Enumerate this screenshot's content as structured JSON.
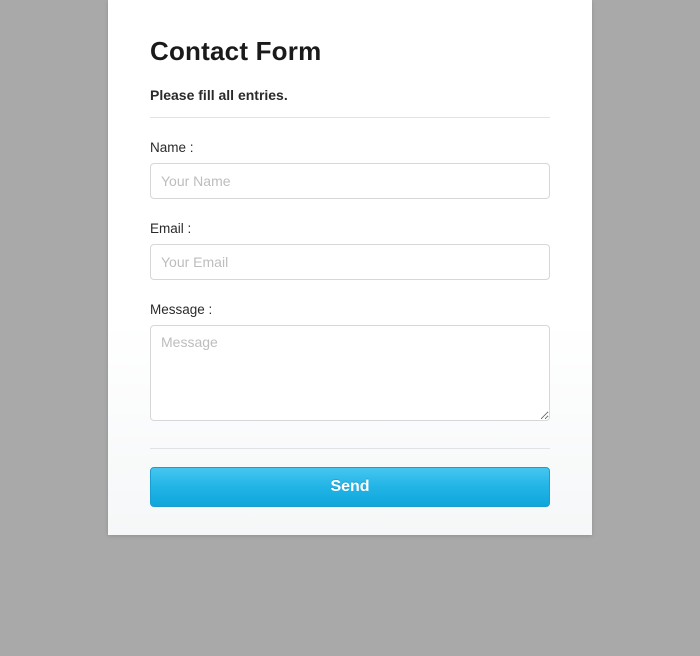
{
  "form": {
    "title": "Contact Form",
    "subtitle": "Please fill all entries.",
    "fields": {
      "name": {
        "label": "Name :",
        "placeholder": "Your Name",
        "value": ""
      },
      "email": {
        "label": "Email :",
        "placeholder": "Your Email",
        "value": ""
      },
      "message": {
        "label": "Message :",
        "placeholder": "Message",
        "value": ""
      }
    },
    "submit_label": "Send"
  }
}
